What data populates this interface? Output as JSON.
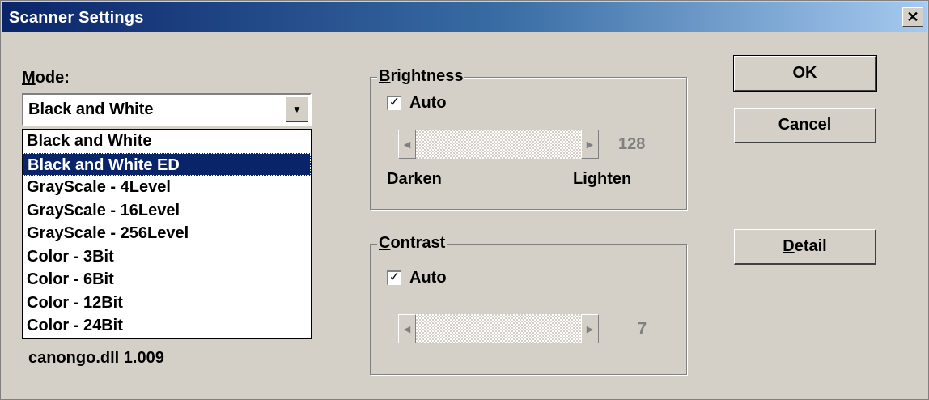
{
  "window": {
    "title": "Scanner Settings",
    "close_glyph": "✕"
  },
  "mode": {
    "label_first": "M",
    "label_rest": "ode:",
    "selected": "Black and White",
    "options": [
      "Black and White",
      "Black and White ED",
      "GrayScale - 4Level",
      "GrayScale - 16Level",
      "GrayScale - 256Level",
      "Color - 3Bit",
      "Color - 6Bit",
      "Color - 12Bit",
      "Color - 24Bit"
    ],
    "highlighted_index": 1
  },
  "brightness": {
    "title_first": "B",
    "title_rest": "rightness",
    "auto_label": "Auto",
    "auto_checked": true,
    "value": "128",
    "left_label": "Darken",
    "right_label": "Lighten"
  },
  "contrast": {
    "title_first": "C",
    "title_rest": "ontrast",
    "auto_label": "Auto",
    "auto_checked": true,
    "value": "7"
  },
  "buttons": {
    "ok": "OK",
    "cancel": "Cancel",
    "detail_first": "D",
    "detail_rest": "etail"
  },
  "version": "canongo.dll 1.009",
  "icons": {
    "close": "close-icon",
    "dropdown": "chevron-down-icon",
    "left": "arrow-left-icon",
    "right": "arrow-right-icon",
    "check": "checkmark-icon"
  },
  "colors": {
    "titlebar_start": "#0a246a",
    "titlebar_end": "#a6caf0",
    "face": "#d4d0c8",
    "selection": "#0a246a"
  }
}
